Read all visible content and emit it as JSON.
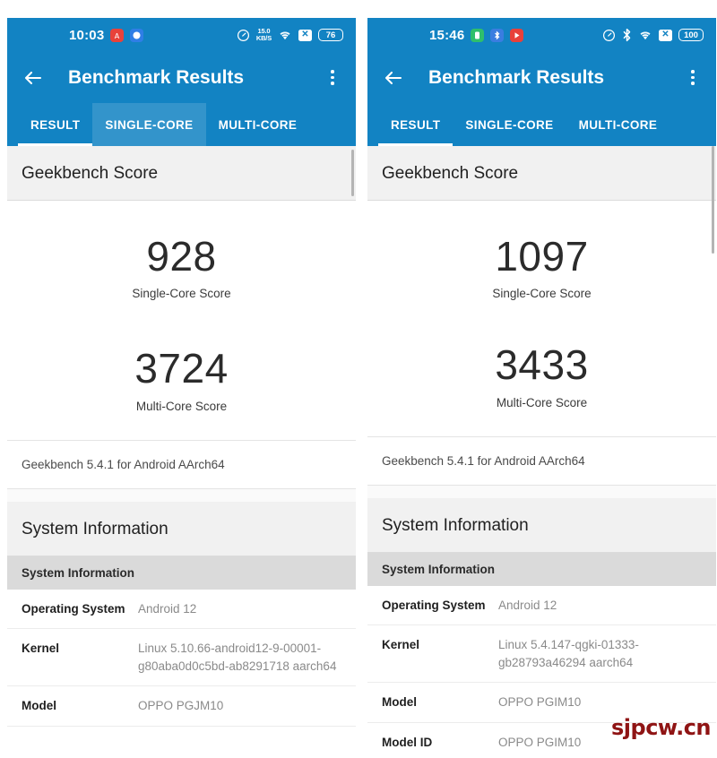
{
  "theme": {
    "primary": "#1283c3",
    "header_bg": "#f1f1f1",
    "subheader_bg": "#dadada",
    "watermark_color": "#8f1414"
  },
  "watermark": "sjpcw.cn",
  "panels": [
    {
      "id": "left",
      "statusbar": {
        "clock": "10:03",
        "left_icons": [
          "app-icon-red",
          "app-icon-blue"
        ],
        "netspeed_value": "15.0",
        "netspeed_unit": "KB/S",
        "right_icons": [
          "speedometer-icon",
          "netspeed-icon",
          "wifi-icon",
          "x-icon"
        ],
        "battery": "76"
      },
      "appbar": {
        "back_icon": "back-arrow-icon",
        "title": "Benchmark Results",
        "overflow_icon": "overflow-menu-icon"
      },
      "tabs": [
        {
          "label": "RESULT",
          "state": "active"
        },
        {
          "label": "SINGLE-CORE",
          "state": "pressed"
        },
        {
          "label": "MULTI-CORE",
          "state": "normal"
        }
      ],
      "score_section": {
        "header": "Geekbench Score",
        "scores": [
          {
            "value": "928",
            "label": "Single-Core Score"
          },
          {
            "value": "3724",
            "label": "Multi-Core Score"
          }
        ],
        "version": "Geekbench 5.4.1 for Android AArch64"
      },
      "system_information": {
        "header": "System Information",
        "subheader": "System Information",
        "rows": [
          {
            "key": "Operating System",
            "value": "Android 12"
          },
          {
            "key": "Kernel",
            "value": "Linux 5.10.66-android12-9-00001-g80aba0d0c5bd-ab8291718 aarch64"
          },
          {
            "key": "Model",
            "value": "OPPO PGJM10"
          }
        ]
      }
    },
    {
      "id": "right",
      "statusbar": {
        "clock": "15:46",
        "left_icons": [
          "app-icon-green",
          "app-icon-bluetooth",
          "app-icon-play"
        ],
        "right_icons": [
          "speedometer-icon",
          "bluetooth-icon",
          "wifi-icon",
          "x-icon"
        ],
        "battery": "100"
      },
      "appbar": {
        "back_icon": "back-arrow-icon",
        "title": "Benchmark Results",
        "overflow_icon": "overflow-menu-icon"
      },
      "tabs": [
        {
          "label": "RESULT",
          "state": "active"
        },
        {
          "label": "SINGLE-CORE",
          "state": "normal"
        },
        {
          "label": "MULTI-CORE",
          "state": "normal"
        }
      ],
      "score_section": {
        "header": "Geekbench Score",
        "scores": [
          {
            "value": "1097",
            "label": "Single-Core Score"
          },
          {
            "value": "3433",
            "label": "Multi-Core Score"
          }
        ],
        "version": "Geekbench 5.4.1 for Android AArch64"
      },
      "system_information": {
        "header": "System Information",
        "subheader": "System Information",
        "rows": [
          {
            "key": "Operating System",
            "value": "Android 12"
          },
          {
            "key": "Kernel",
            "value": "Linux 5.4.147-qgki-01333-gb28793a46294 aarch64"
          },
          {
            "key": "Model",
            "value": "OPPO PGIM10"
          },
          {
            "key": "Model ID",
            "value": "OPPO PGIM10"
          }
        ]
      }
    }
  ]
}
